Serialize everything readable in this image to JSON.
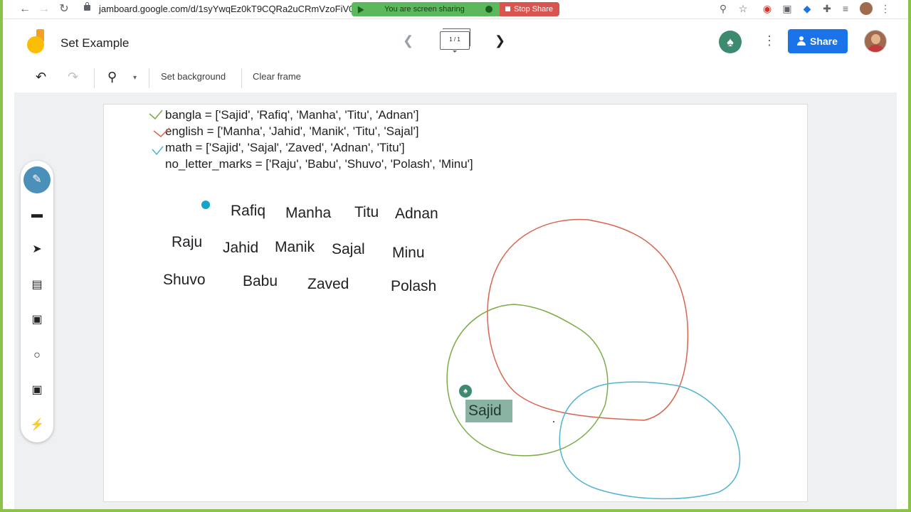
{
  "browser": {
    "url": "jamboard.google.com/d/1syYwqEz0kT9CQRa2uCRmVzoFiV0o",
    "screen_share_text": "You are screen sharing",
    "stop_share_label": "Stop Share"
  },
  "header": {
    "title": "Set Example",
    "frame_counter": "1 / 1",
    "share_label": "Share"
  },
  "toolbar": {
    "set_background_label": "Set background",
    "clear_frame_label": "Clear frame"
  },
  "board": {
    "code_lines": [
      "bangla = ['Sajid', 'Rafiq', 'Manha', 'Titu', 'Adnan']",
      "english = ['Manha', 'Jahid', 'Manik', 'Titu', 'Sajal']",
      "math = ['Sajid', 'Sajal', 'Zaved', 'Adnan', 'Titu']",
      "no_letter_marks = ['Raju', 'Babu', 'Shuvo', 'Polash', 'Minu']"
    ],
    "names": {
      "rafiq": "Rafiq",
      "manha": "Manha",
      "titu": "Titu",
      "adnan": "Adnan",
      "raju": "Raju",
      "jahid": "Jahid",
      "manik": "Manik",
      "sajal": "Sajal",
      "minu": "Minu",
      "shuvo": "Shuvo",
      "babu": "Babu",
      "zaved": "Zaved",
      "polash": "Polash"
    },
    "sajid_chip": "Sajid"
  },
  "colors": {
    "accent": "#1a73e8",
    "bangla_circle": "#d9654f",
    "english_circle": "#7cab4a",
    "math_circle": "#4fb3d1",
    "frame_border": "#8bc34a"
  }
}
